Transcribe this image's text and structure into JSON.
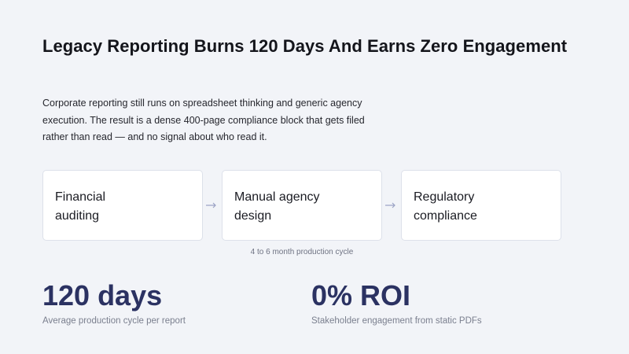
{
  "slide": {
    "title": "Legacy Reporting Burns 120 Days And Earns Zero Engagement",
    "body": "Corporate reporting still runs on spreadsheet thinking and generic agency execution. The result is a dense 400-page compliance block that gets filed rather than read — and no signal about who read it.",
    "flow": {
      "steps": [
        {
          "label": "Financial auditing"
        },
        {
          "label": "Manual agency design"
        },
        {
          "label": "Regulatory compliance"
        }
      ],
      "note": "4 to 6 month production cycle"
    },
    "stats": [
      {
        "value": "120 days",
        "caption": "Average production cycle per report"
      },
      {
        "value": "0% ROI",
        "caption": "Stakeholder engagement from static PDFs"
      }
    ]
  },
  "colors": {
    "background": "#f2f4f8",
    "stat_accent": "#2b3262",
    "arrow": "#9aa1c4"
  },
  "icons": {
    "flow_connector": "arrow-right-icon"
  }
}
